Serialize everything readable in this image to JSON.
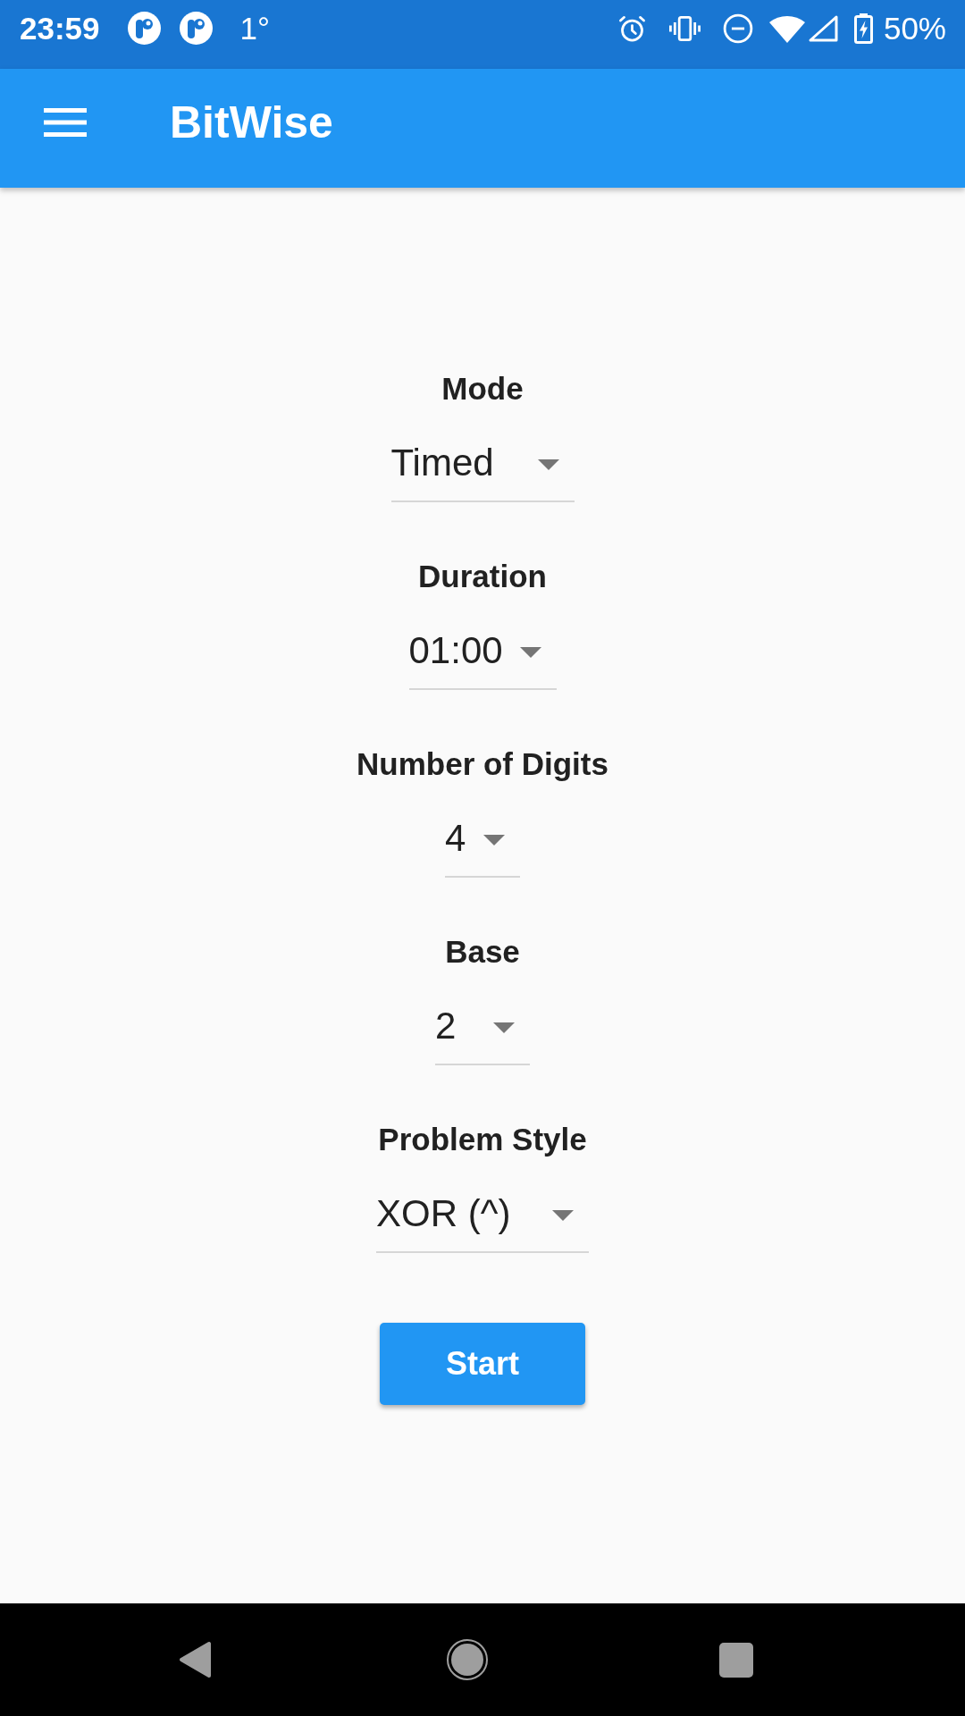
{
  "status_bar": {
    "time": "23:59",
    "temperature": "1°",
    "battery": "50%"
  },
  "app_bar": {
    "title": "BitWise"
  },
  "settings": [
    {
      "label": "Mode",
      "value": "Timed"
    },
    {
      "label": "Duration",
      "value": "01:00"
    },
    {
      "label": "Number of Digits",
      "value": "4"
    },
    {
      "label": "Base",
      "value": "2"
    },
    {
      "label": "Problem Style",
      "value": "XOR (^)"
    }
  ],
  "start_button": {
    "label": "Start"
  }
}
